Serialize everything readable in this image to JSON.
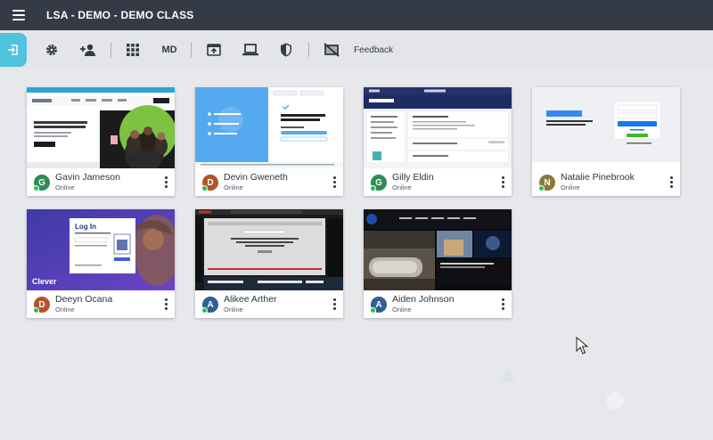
{
  "app": {
    "title": "LSA - DEMO - DEMO CLASS"
  },
  "toolbar": {
    "md_label": "MD",
    "feedback_label": "Feedback",
    "icons": [
      "exit-icon",
      "gear-icon",
      "add-person-icon",
      "grid-icon",
      "open-tab-icon",
      "screen-icon",
      "shield-icon",
      "screen-off-icon"
    ]
  },
  "colors": {
    "topbar": "#343b47",
    "accent": "#4fc3dd",
    "online": "#2cbf4e",
    "avatar_green": "#2e8b57",
    "avatar_rust": "#b3532a",
    "avatar_olive": "#8a7a3a",
    "avatar_blue": "#2f5f93"
  },
  "students": [
    {
      "name": "Gavin Jameson",
      "status": "Online",
      "initial": "G",
      "avatar_color": "#2e8b57"
    },
    {
      "name": "Devin Gweneth",
      "status": "Online",
      "initial": "D",
      "avatar_color": "#b3532a"
    },
    {
      "name": "Gilly Eldin",
      "status": "Online",
      "initial": "G",
      "avatar_color": "#2e8b57"
    },
    {
      "name": "Natalie Pinebrook",
      "status": "Online",
      "initial": "N",
      "avatar_color": "#8a7a3a"
    },
    {
      "name": "Deeyn Ocana",
      "status": "Online",
      "initial": "D",
      "avatar_color": "#b3532a"
    },
    {
      "name": "Alikee Arther",
      "status": "Online",
      "initial": "A",
      "avatar_color": "#2f5f93"
    },
    {
      "name": "Aiden Johnson",
      "status": "Online",
      "initial": "A",
      "avatar_color": "#2f5f93"
    }
  ],
  "screens": {
    "gavin": {
      "headline": "Lead with heart. Guide with LanSchool."
    },
    "devin": {
      "headline": "See what's happening in the world right now"
    },
    "gilly": {
      "heading": "Classroom"
    },
    "natalie": {
      "logo": "facebook",
      "tagline": "Connect with friends and the world around you on Facebook.",
      "button": "Log In"
    },
    "deeyn": {
      "title": "Log In",
      "brand": "Clever",
      "badge": "Clever"
    },
    "alikee": {
      "message": "This browser you're attempting to access is currently restricted."
    }
  }
}
